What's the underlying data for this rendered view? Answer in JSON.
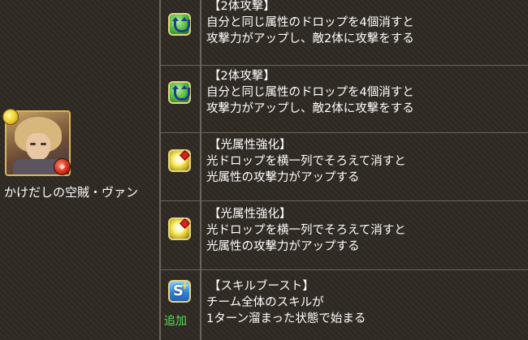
{
  "character": {
    "name": "かけだしの空賊・ヴァン",
    "attribute": "light",
    "awakening_badge_icon": "red-awakening-icon"
  },
  "skills": [
    {
      "icon": "two-pronged-attack-icon",
      "title": "【2体攻撃】",
      "desc_line1": "自分と同じ属性のドロップを4個消すと",
      "desc_line2": "攻撃力がアップし、敵2体に攻撃をする"
    },
    {
      "icon": "two-pronged-attack-icon",
      "title": "【2体攻撃】",
      "desc_line1": "自分と同じ属性のドロップを4個消すと",
      "desc_line2": "攻撃力がアップし、敵2体に攻撃をする"
    },
    {
      "icon": "light-row-enhance-icon",
      "title": "【光属性強化】",
      "desc_line1": "光ドロップを横一列でそろえて消すと",
      "desc_line2": "光属性の攻撃力がアップする"
    },
    {
      "icon": "light-row-enhance-icon",
      "title": "【光属性強化】",
      "desc_line1": "光ドロップを横一列でそろえて消すと",
      "desc_line2": "光属性の攻撃力がアップする"
    },
    {
      "icon": "skill-boost-icon",
      "added_label": "追加",
      "title": "【スキルブースト】",
      "desc_line1": "チーム全体のスキルが",
      "desc_line2": "1ターン溜まった状態で始まる"
    }
  ],
  "colors": {
    "background": "#2f2a24",
    "grid": "#6d655b",
    "text": "#ffffff",
    "added_label": "#57e05a"
  }
}
